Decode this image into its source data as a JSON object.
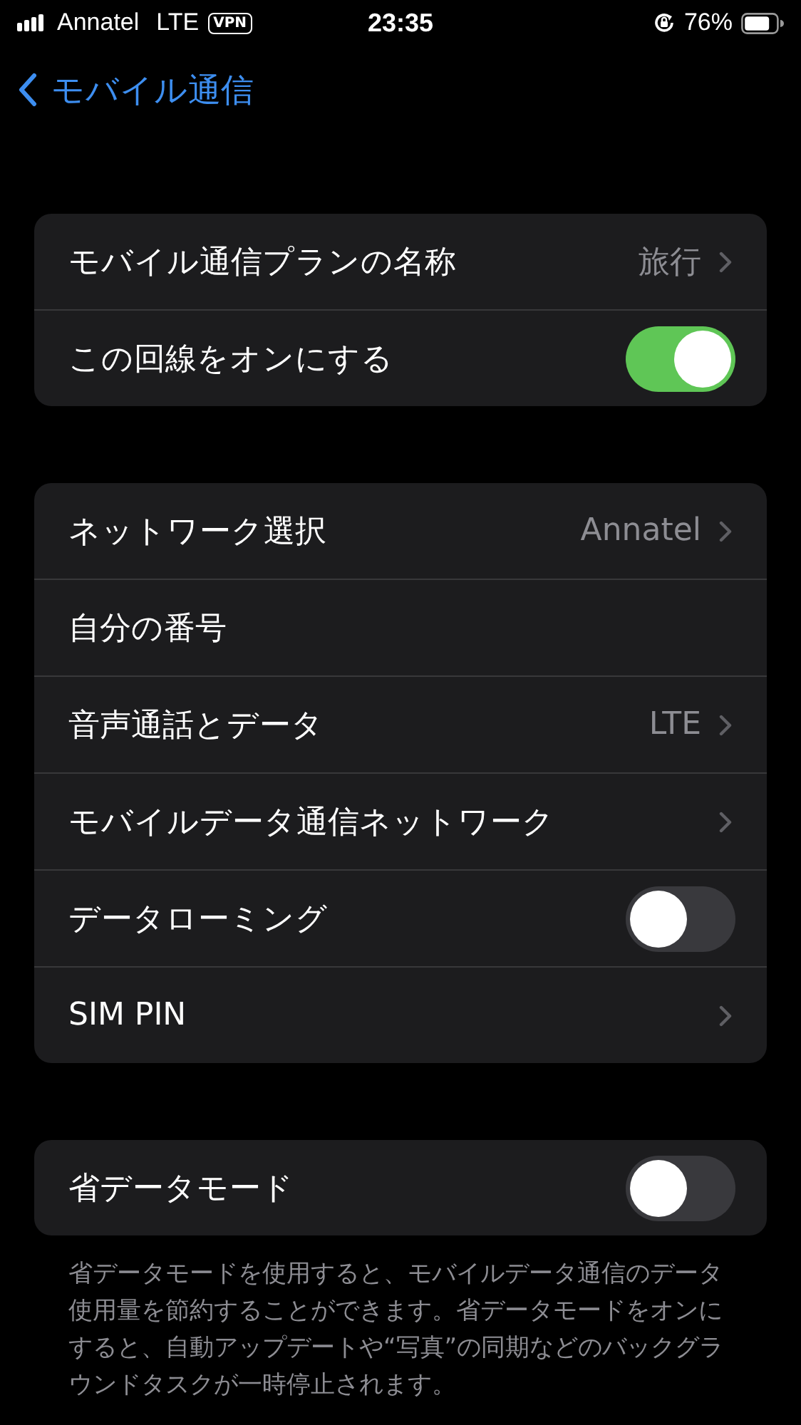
{
  "status_bar": {
    "carrier": "Annatel",
    "network": "LTE",
    "vpn": "VPN",
    "time": "23:35",
    "battery": "76%"
  },
  "nav": {
    "back": "モバイル通信"
  },
  "groups": [
    {
      "rows": [
        {
          "kind": "value",
          "label": "モバイル通信プランの名称",
          "value": "旅行"
        },
        {
          "kind": "toggle",
          "label": "この回線をオンにする",
          "on": true
        }
      ]
    },
    {
      "rows": [
        {
          "kind": "value",
          "label": "ネットワーク選択",
          "value": "Annatel"
        },
        {
          "kind": "plain",
          "label": "自分の番号"
        },
        {
          "kind": "value",
          "label": "音声通話とデータ",
          "value": "LTE"
        },
        {
          "kind": "chevron",
          "label": "モバイルデータ通信ネットワーク"
        },
        {
          "kind": "toggle",
          "label": "データローミング",
          "on": false
        },
        {
          "kind": "chevron",
          "label": "SIM PIN"
        }
      ]
    },
    {
      "rows": [
        {
          "kind": "toggle",
          "label": "省データモード",
          "on": false
        }
      ],
      "footer": "省データモードを使用すると、モバイルデータ通信のデータ使用量を節約することができます。省データモードをオンにすると、自動アップデートや“写真”の同期などのバックグラウンドタスクが一時停止されます。"
    }
  ]
}
